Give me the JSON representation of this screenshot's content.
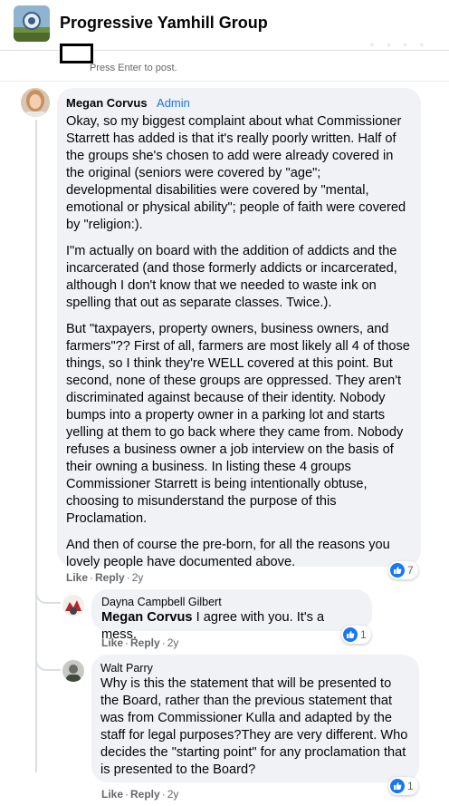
{
  "header": {
    "group_name": "Progressive Yamhill Group"
  },
  "composer": {
    "hint": "Press Enter to post."
  },
  "comments": [
    {
      "author": "Megan Corvus",
      "badge": "Admin",
      "paragraphs": [
        "Okay, so my biggest complaint about what Commissioner Starrett has added is that it's really poorly written. Half of the groups she's chosen to add were already covered in the original (seniors were covered by \"age\"; developmental disabilities were covered by \"mental, emotional or physical ability\"; people of faith were covered by \"religion:).",
        "I\"m actually on board with the addition of addicts and the incarcerated (and those formerly addicts or incarcerated, although I don't know that we needed to waste ink on spelling that out as separate classes. Twice.).",
        "But \"taxpayers, property owners, business owners, and farmers\"?? First of all, farmers are most likely all 4 of those things, so I think they're WELL covered at this point. But second, none of these groups are oppressed. They aren't discriminated against because of their identity. Nobody bumps into a property owner in a parking lot and starts yelling at them to go back where they came from. Nobody refuses a business owner a job interview on the basis of their owning a business. In listing these 4 groups Commissioner Starrett is being intentionally obtuse, choosing to misunderstand the purpose of this Proclamation.",
        "And then of course the pre-born, for all the reasons you lovely people have documented above."
      ],
      "like_label": "Like",
      "reply_label": "Reply",
      "time": "2y",
      "reaction_count": "7"
    }
  ],
  "replies": [
    {
      "author": "Dayna Campbell Gilbert",
      "mention": "Megan Corvus",
      "text": " I agree with you. It's a mess.",
      "like_label": "Like",
      "reply_label": "Reply",
      "time": "2y",
      "reaction_count": "1"
    },
    {
      "author": "Walt Parry",
      "text": "Why is this the statement that will be presented to the Board, rather than the previous statement that was from Commissioner Kulla and adapted by the staff for legal purposes?They are very different. Who decides the \"starting point\" for any proclamation that is presented to the Board?",
      "like_label": "Like",
      "reply_label": "Reply",
      "time": "2y",
      "reaction_count": "1"
    }
  ],
  "colors": {
    "bubble": "#f0f2f5",
    "link_blue": "#1b74e4",
    "like_blue": "#1877f2",
    "meta_gray": "#65676b"
  },
  "icons": {
    "like": "thumbs-up-icon"
  }
}
